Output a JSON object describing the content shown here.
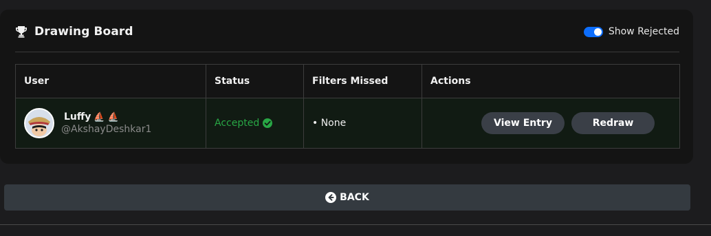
{
  "card": {
    "title": "Drawing Board",
    "title_icon": "trophy-icon",
    "toggle": {
      "label": "Show Rejected",
      "checked": true,
      "accent": "#0d6efd"
    }
  },
  "table": {
    "headers": [
      "User",
      "Status",
      "Filters Missed",
      "Actions"
    ],
    "rows": [
      {
        "user": {
          "name": "Luffy",
          "badges": [
            "⛵",
            "⛵"
          ],
          "handle": "@AkshayDeshkar1",
          "avatar": "avatar"
        },
        "status": "Accepted",
        "status_color": "#28a745",
        "status_icon": "check-circle-icon",
        "filters_missed": "• None",
        "actions": {
          "view": "View Entry",
          "redraw": "Redraw"
        }
      }
    ]
  },
  "back": {
    "label": "BACK",
    "icon": "arrow-left-circle-icon"
  }
}
